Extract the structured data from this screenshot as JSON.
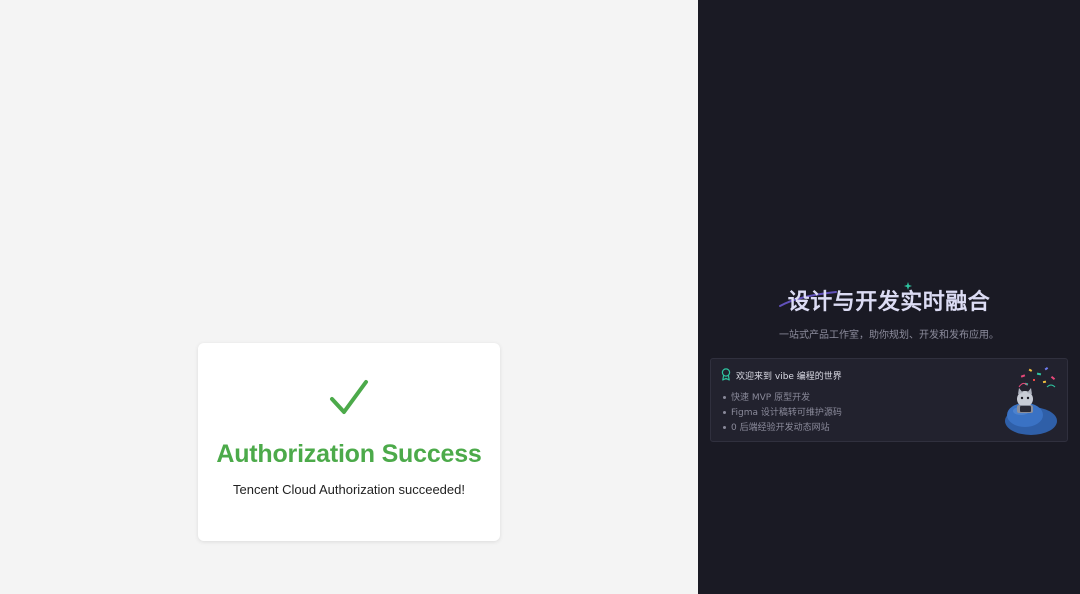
{
  "auth_card": {
    "icon": "checkmark-icon",
    "title": "Authorization Success",
    "message": "Tencent Cloud Authorization succeeded!"
  },
  "hero": {
    "title": "设计与开发实时融合",
    "subtitle": "一站式产品工作室，助你规划、开发和发布应用。"
  },
  "welcome": {
    "icon": "award-icon",
    "title": "欢迎来到 vibe 编程的世界",
    "features": [
      "快速 MVP 原型开发",
      "Figma 设计稿转可维护源码",
      "0 后端经验开发动态网站"
    ],
    "illustration": "mascot-on-beanbag"
  },
  "colors": {
    "success_green": "#4caa4a",
    "left_bg": "#f4f4f4",
    "right_bg": "#1a1a24",
    "accent_teal": "#2ec4a0"
  }
}
